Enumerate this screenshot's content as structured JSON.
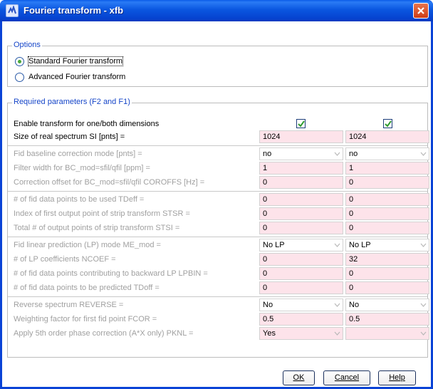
{
  "window": {
    "title": "Fourier transform - xfb"
  },
  "options": {
    "legend": "Options",
    "radios": [
      {
        "label": "Standard Fourier transform",
        "checked": true
      },
      {
        "label": "Advanced Fourier transform",
        "checked": false
      }
    ]
  },
  "required": {
    "legend": "Required parameters (F2 and F1)",
    "enable_label": "Enable transform for one/both dimensions",
    "enable": [
      true,
      true
    ],
    "si_label": "Size of real spectrum SI [pnts] =",
    "si": [
      "1024",
      "1024"
    ],
    "bc_mod_label": "Fid baseline correction mode [pnts] =",
    "bc_mod": [
      "no",
      "no"
    ],
    "bcfw_label": "Filter width for BC_mod=sfil/qfil [ppm] =",
    "bcfw": [
      "1",
      "1"
    ],
    "coroffs_label": "Correction offset for BC_mod=sfil/qfil COROFFS [Hz] =",
    "coroffs": [
      "0",
      "0"
    ],
    "tdeff_label": "# of fid data points to be used TDeff =",
    "tdeff": [
      "0",
      "0"
    ],
    "stsr_label": "Index of first output point of strip transform STSR =",
    "stsr": [
      "0",
      "0"
    ],
    "stsi_label": "Total # of output points of strip transform STSI =",
    "stsi": [
      "0",
      "0"
    ],
    "me_mod_label": "Fid linear prediction (LP) mode ME_mod =",
    "me_mod": [
      "No LP",
      "No LP"
    ],
    "ncoef_label": "# of LP coefficients NCOEF =",
    "ncoef": [
      "0",
      "32"
    ],
    "lpbin_label": "# of fid data points contributing to backward LP LPBIN =",
    "lpbin": [
      "0",
      "0"
    ],
    "tdoff_label": "# of fid data points to be predicted TDoff =",
    "tdoff": [
      "0",
      "0"
    ],
    "reverse_label": "Reverse spectrum REVERSE =",
    "reverse": [
      "No",
      "No"
    ],
    "fcor_label": "Weighting factor for first fid point FCOR =",
    "fcor": [
      "0.5",
      "0.5"
    ],
    "pknl_label": "Apply 5th order phase correction (A*X only) PKNL =",
    "pknl": [
      "Yes",
      ""
    ]
  },
  "buttons": {
    "ok": "OK",
    "cancel": "Cancel",
    "help": "Help"
  },
  "colors": {
    "titlebar": "#0a56e0",
    "legend": "#1545c8",
    "field_bg": "#fde3ea",
    "check": "#2f9b2f"
  }
}
